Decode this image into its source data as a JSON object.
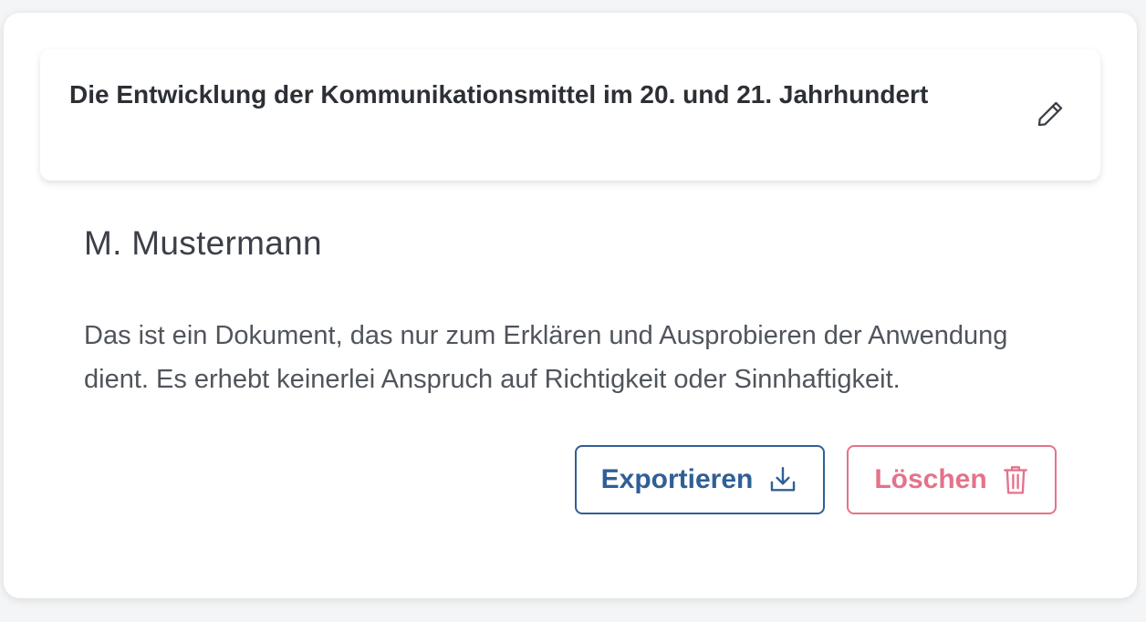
{
  "document": {
    "title": "Die Entwicklung der Kommunikationsmittel im 20. und 21. Jahrhundert",
    "author": "M. Mustermann",
    "description": "Das ist ein Dokument, das nur zum Erklären und Ausprobieren der Anwendung dient. Es erhebt keinerlei Anspruch auf Richtigkeit oder Sinnhaftigkeit."
  },
  "actions": {
    "export_label": "Exportieren",
    "delete_label": "Löschen"
  },
  "icons": {
    "edit": "pencil-icon",
    "export": "download-icon",
    "delete": "trash-icon"
  },
  "colors": {
    "export_accent": "#2f5f96",
    "delete_accent": "#e3738a",
    "title_text": "#2c3035"
  }
}
